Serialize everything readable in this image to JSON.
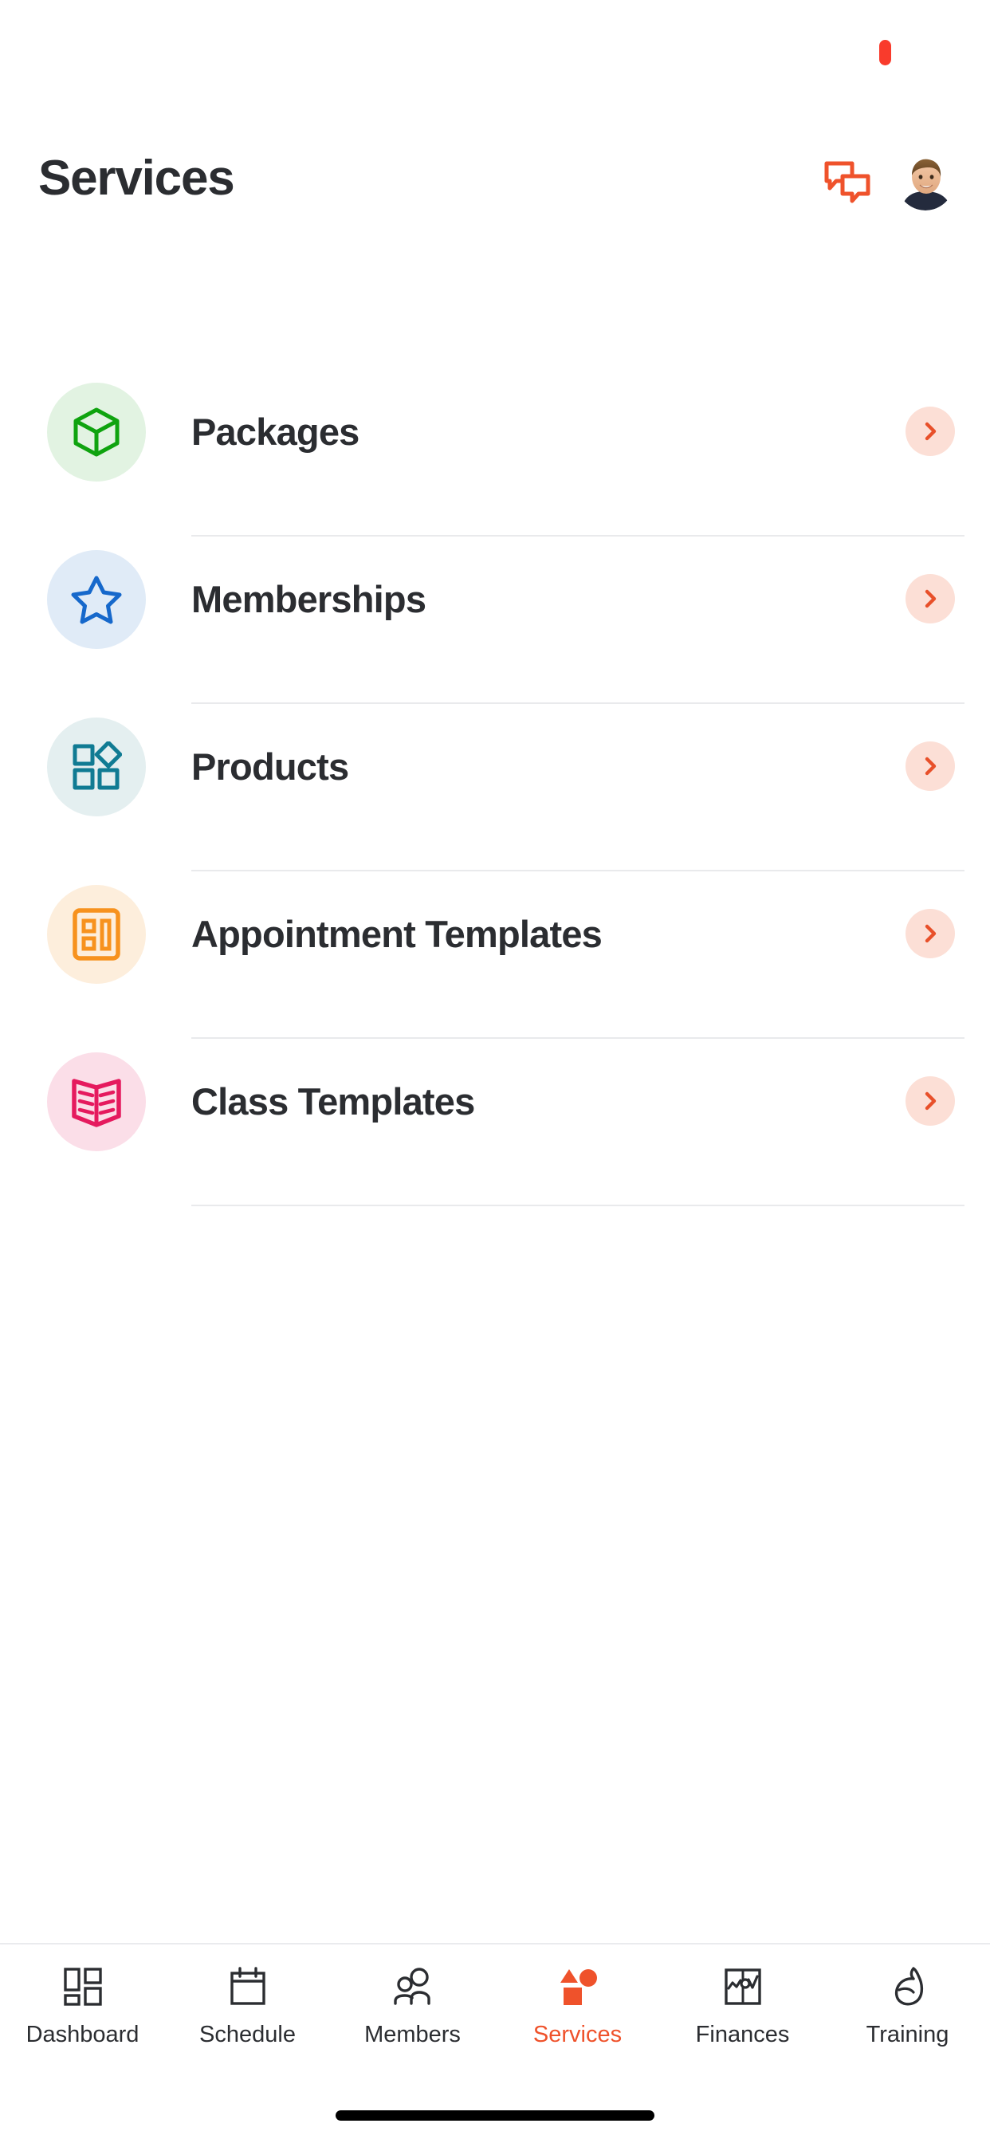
{
  "status_bar": {
    "recording_indicator_color": "#F93B2C"
  },
  "header": {
    "title": "Services",
    "chat_icon": "chat-bubbles-icon",
    "chat_icon_color": "#EF522B",
    "avatar_icon": "user-avatar-photo",
    "avatar_alt": "User profile photo"
  },
  "theme": {
    "accent": "#EF522B",
    "text": "#2B2D31",
    "divider": "#E9EAEC",
    "chevron_bg": "#FCDFD6"
  },
  "services_list": {
    "items": [
      {
        "label": "Packages",
        "icon": "cube-icon",
        "icon_color": "#0FA30F",
        "icon_bg": "#E2F3E2",
        "chevron": "chevron-right-icon"
      },
      {
        "label": "Memberships",
        "icon": "star-icon",
        "icon_color": "#1668CB",
        "icon_bg": "#E0EBF7",
        "chevron": "chevron-right-icon"
      },
      {
        "label": "Products",
        "icon": "shapes-grid-icon",
        "icon_color": "#107B93",
        "icon_bg": "#E4EFF0",
        "chevron": "chevron-right-icon"
      },
      {
        "label": "Appointment Templates",
        "icon": "appointment-card-icon",
        "icon_color": "#F7921E",
        "icon_bg": "#FDEEDC",
        "chevron": "chevron-right-icon"
      },
      {
        "label": "Class Templates",
        "icon": "open-book-icon",
        "icon_color": "#E51A5E",
        "icon_bg": "#FBDEE8",
        "chevron": "chevron-right-icon"
      }
    ]
  },
  "bottom_nav": {
    "active_index": 3,
    "active_color": "#EF522B",
    "inactive_color": "#2B2D31",
    "items": [
      {
        "label": "Dashboard",
        "icon": "grid-dashboard-icon",
        "active": false
      },
      {
        "label": "Schedule",
        "icon": "calendar-icon",
        "active": false
      },
      {
        "label": "Members",
        "icon": "people-icon",
        "active": false
      },
      {
        "label": "Services",
        "icon": "shapes-icon",
        "active": true
      },
      {
        "label": "Finances",
        "icon": "chart-box-icon",
        "active": false
      },
      {
        "label": "Training",
        "icon": "biceps-icon",
        "active": false
      }
    ]
  },
  "home_indicator": {
    "color": "#000000"
  }
}
